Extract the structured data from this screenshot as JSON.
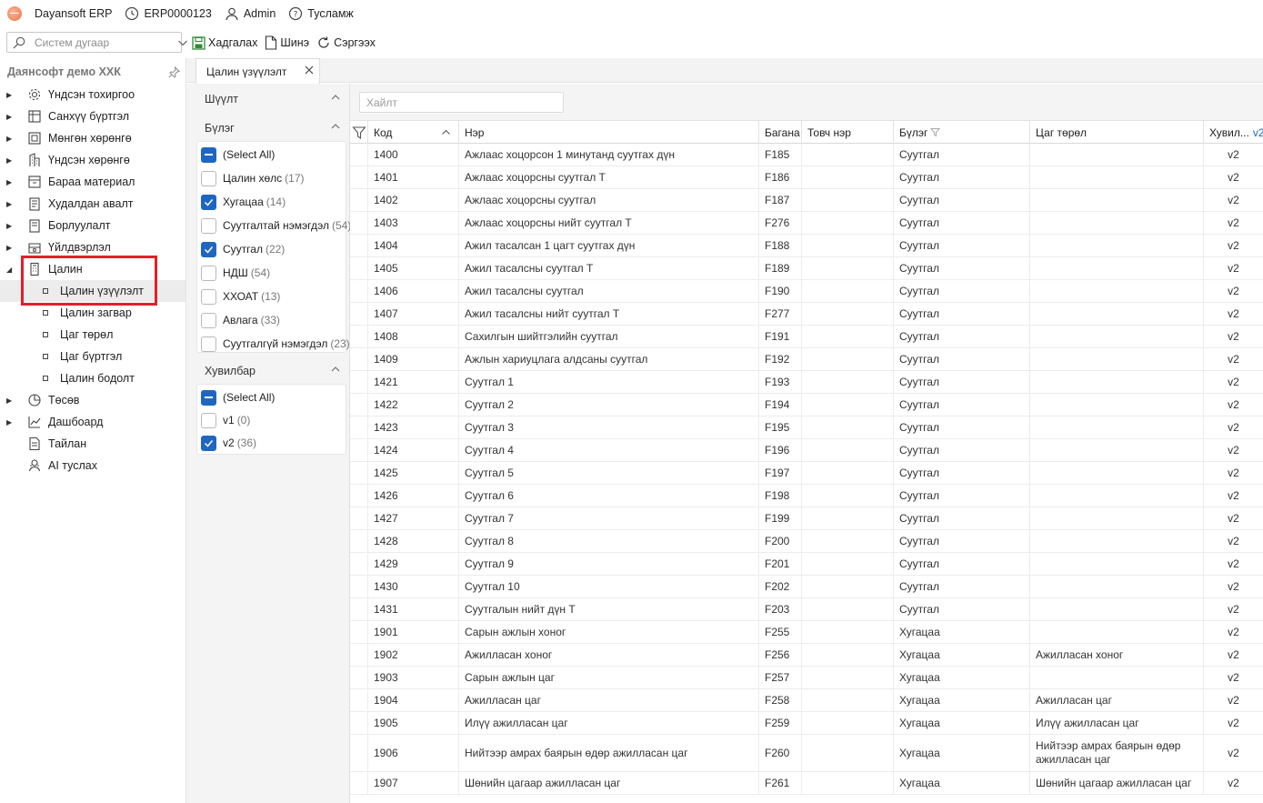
{
  "app": {
    "name": "Dayansoft ERP",
    "db": "ERP0000123",
    "user": "Admin",
    "help": "Тусламж"
  },
  "system_search": {
    "placeholder": "Систем дугаар"
  },
  "toolbar": {
    "save": "Хадгалах",
    "new": "Шинэ",
    "refresh": "Сэргээх"
  },
  "sidebar": {
    "company": "Даянсофт демо ХХК",
    "items": [
      {
        "label": "Үндсэн тохиргоо",
        "icon": "gear-icon",
        "expanded": false
      },
      {
        "label": "Санхүү бүртгэл",
        "icon": "ledger-icon",
        "expanded": false
      },
      {
        "label": "Мөнгөн хөрөнгө",
        "icon": "cash-icon",
        "expanded": false
      },
      {
        "label": "Үндсэн хөрөнгө",
        "icon": "building-icon",
        "expanded": false
      },
      {
        "label": "Бараа материал",
        "icon": "box-icon",
        "expanded": false
      },
      {
        "label": "Худалдан авалт",
        "icon": "purchase-icon",
        "expanded": false
      },
      {
        "label": "Борлуулалт",
        "icon": "sales-icon",
        "expanded": false
      },
      {
        "label": "Үйлдвэрлэл",
        "icon": "factory-icon",
        "expanded": false
      },
      {
        "label": "Цалин",
        "icon": "calculator-icon",
        "expanded": true
      },
      {
        "label": "Төсөв",
        "icon": "pie-chart-icon",
        "expanded": false
      },
      {
        "label": "Дашбоард",
        "icon": "dashboard-icon",
        "expanded": false
      },
      {
        "label": "Тайлан",
        "icon": "report-icon",
        "expanded": false
      },
      {
        "label": "AI туслах",
        "icon": "ai-assistant-icon",
        "expanded": false
      }
    ],
    "salary_children": [
      {
        "label": "Цалин үзүүлэлт",
        "active": true
      },
      {
        "label": "Цалин загвар",
        "active": false
      },
      {
        "label": "Цаг төрөл",
        "active": false
      },
      {
        "label": "Цаг бүртгэл",
        "active": false
      },
      {
        "label": "Цалин бодолт",
        "active": false
      }
    ]
  },
  "tab": {
    "label": "Цалин үзүүлэлт"
  },
  "filter_panel": {
    "columns_header": "Шүүлт",
    "group_header": "Бүлэг",
    "group_options": [
      {
        "label": "(Select All)",
        "count": "",
        "state": "indeterminate"
      },
      {
        "label": "Цалин хөлс",
        "count": "(17)",
        "state": "off"
      },
      {
        "label": "Хугацаа",
        "count": "(14)",
        "state": "on"
      },
      {
        "label": "Суутгалтай нэмэгдэл",
        "count": "(54)",
        "state": "off"
      },
      {
        "label": "Суутгал",
        "count": "(22)",
        "state": "on"
      },
      {
        "label": "НДШ",
        "count": "(54)",
        "state": "off"
      },
      {
        "label": "ХХОАТ",
        "count": "(13)",
        "state": "off"
      },
      {
        "label": "Авлага",
        "count": "(33)",
        "state": "off"
      },
      {
        "label": "Суутгалгүй нэмэгдэл",
        "count": "(23)",
        "state": "off"
      }
    ],
    "version_header": "Хувилбар",
    "version_options": [
      {
        "label": "(Select All)",
        "count": "",
        "state": "indeterminate"
      },
      {
        "label": "v1",
        "count": "(0)",
        "state": "off"
      },
      {
        "label": "v2",
        "count": "(36)",
        "state": "on"
      }
    ]
  },
  "grid": {
    "search_placeholder": "Хайлт",
    "columns": [
      "Код",
      "Нэр",
      "Багана",
      "Товч нэр",
      "Бүлэг",
      "Цаг төрөл",
      "Хувил..."
    ],
    "version_header_tag": "v2",
    "rows": [
      {
        "code": "1400",
        "name": "Ажлаас хоцорсон 1 минутанд суутгах дүн",
        "column": "F185",
        "short": "",
        "group": "Суутгал",
        "time_type": "",
        "version": "v2"
      },
      {
        "code": "1401",
        "name": "Ажлаас хоцорсны суутгал Т",
        "column": "F186",
        "short": "",
        "group": "Суутгал",
        "time_type": "",
        "version": "v2"
      },
      {
        "code": "1402",
        "name": "Ажлаас хоцорсны суутгал",
        "column": "F187",
        "short": "",
        "group": "Суутгал",
        "time_type": "",
        "version": "v2"
      },
      {
        "code": "1403",
        "name": "Ажлаас хоцорсны нийт суутгал Т",
        "column": "F276",
        "short": "",
        "group": "Суутгал",
        "time_type": "",
        "version": "v2"
      },
      {
        "code": "1404",
        "name": "Ажил тасалсан 1 цагт суутгах дүн",
        "column": "F188",
        "short": "",
        "group": "Суутгал",
        "time_type": "",
        "version": "v2"
      },
      {
        "code": "1405",
        "name": "Ажил тасалсны суутгал Т",
        "column": "F189",
        "short": "",
        "group": "Суутгал",
        "time_type": "",
        "version": "v2"
      },
      {
        "code": "1406",
        "name": "Ажил тасалсны суутгал",
        "column": "F190",
        "short": "",
        "group": "Суутгал",
        "time_type": "",
        "version": "v2"
      },
      {
        "code": "1407",
        "name": "Ажил тасалсны нийт суутгал Т",
        "column": "F277",
        "short": "",
        "group": "Суутгал",
        "time_type": "",
        "version": "v2"
      },
      {
        "code": "1408",
        "name": "Сахилгын шийтгэлийн суутгал",
        "column": "F191",
        "short": "",
        "group": "Суутгал",
        "time_type": "",
        "version": "v2"
      },
      {
        "code": "1409",
        "name": "Ажлын хариуцлага алдсаны суутгал",
        "column": "F192",
        "short": "",
        "group": "Суутгал",
        "time_type": "",
        "version": "v2"
      },
      {
        "code": "1421",
        "name": "Суутгал 1",
        "column": "F193",
        "short": "",
        "group": "Суутгал",
        "time_type": "",
        "version": "v2"
      },
      {
        "code": "1422",
        "name": "Суутгал 2",
        "column": "F194",
        "short": "",
        "group": "Суутгал",
        "time_type": "",
        "version": "v2"
      },
      {
        "code": "1423",
        "name": "Суутгал 3",
        "column": "F195",
        "short": "",
        "group": "Суутгал",
        "time_type": "",
        "version": "v2"
      },
      {
        "code": "1424",
        "name": "Суутгал 4",
        "column": "F196",
        "short": "",
        "group": "Суутгал",
        "time_type": "",
        "version": "v2"
      },
      {
        "code": "1425",
        "name": "Суутгал 5",
        "column": "F197",
        "short": "",
        "group": "Суутгал",
        "time_type": "",
        "version": "v2"
      },
      {
        "code": "1426",
        "name": "Суутгал 6",
        "column": "F198",
        "short": "",
        "group": "Суутгал",
        "time_type": "",
        "version": "v2"
      },
      {
        "code": "1427",
        "name": "Суутгал 7",
        "column": "F199",
        "short": "",
        "group": "Суутгал",
        "time_type": "",
        "version": "v2"
      },
      {
        "code": "1428",
        "name": "Суутгал 8",
        "column": "F200",
        "short": "",
        "group": "Суутгал",
        "time_type": "",
        "version": "v2"
      },
      {
        "code": "1429",
        "name": "Суутгал 9",
        "column": "F201",
        "short": "",
        "group": "Суутгал",
        "time_type": "",
        "version": "v2"
      },
      {
        "code": "1430",
        "name": "Суутгал 10",
        "column": "F202",
        "short": "",
        "group": "Суутгал",
        "time_type": "",
        "version": "v2"
      },
      {
        "code": "1431",
        "name": "Суутгалын нийт дүн Т",
        "column": "F203",
        "short": "",
        "group": "Суутгал",
        "time_type": "",
        "version": "v2"
      },
      {
        "code": "1901",
        "name": "Сарын ажлын хоног",
        "column": "F255",
        "short": "",
        "group": "Хугацаа",
        "time_type": "",
        "version": "v2"
      },
      {
        "code": "1902",
        "name": "Ажилласан хоног",
        "column": "F256",
        "short": "",
        "group": "Хугацаа",
        "time_type": "Ажилласан хоног",
        "version": "v2"
      },
      {
        "code": "1903",
        "name": "Сарын ажлын цаг",
        "column": "F257",
        "short": "",
        "group": "Хугацаа",
        "time_type": "",
        "version": "v2"
      },
      {
        "code": "1904",
        "name": "Ажилласан цаг",
        "column": "F258",
        "short": "",
        "group": "Хугацаа",
        "time_type": "Ажилласан цаг",
        "version": "v2"
      },
      {
        "code": "1905",
        "name": "Илүү ажилласан цаг",
        "column": "F259",
        "short": "",
        "group": "Хугацаа",
        "time_type": "Илүү ажилласан цаг",
        "version": "v2"
      },
      {
        "code": "1906",
        "name": "Нийтээр амрах баярын өдөр ажилласан цаг",
        "column": "F260",
        "short": "",
        "group": "Хугацаа",
        "time_type": "Нийтээр амрах баярын өдөр ажилласан цаг",
        "version": "v2"
      },
      {
        "code": "1907",
        "name": "Шөнийн цагаар ажилласан цаг",
        "column": "F261",
        "short": "",
        "group": "Хугацаа",
        "time_type": "Шөнийн цагаар ажилласан цаг",
        "version": "v2"
      }
    ]
  }
}
